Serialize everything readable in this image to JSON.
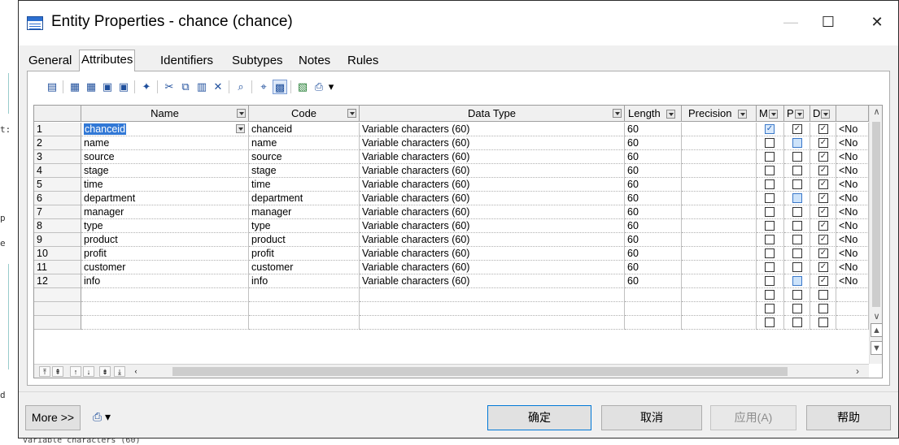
{
  "window": {
    "title": "Entity Properties - chance (chance)"
  },
  "tabs": [
    "General",
    "Attributes",
    "Identifiers",
    "Subtypes",
    "Notes",
    "Rules"
  ],
  "active_tab": "Attributes",
  "grid": {
    "headers": {
      "name": "Name",
      "code": "Code",
      "data_type": "Data Type",
      "length": "Length",
      "precision": "Precision",
      "m": "M",
      "p": "P",
      "d": "D"
    },
    "rows": [
      {
        "num": "1",
        "name": "chanceid",
        "code": "chanceid",
        "data_type": "Variable characters (60)",
        "length": "60",
        "precision": "",
        "m": "bluecheck",
        "p": "checked",
        "d": "checked",
        "extra": "<No"
      },
      {
        "num": "2",
        "name": "name",
        "code": "name",
        "data_type": "Variable characters (60)",
        "length": "60",
        "precision": "",
        "m": "empty",
        "p": "blue",
        "d": "checked",
        "extra": "<No"
      },
      {
        "num": "3",
        "name": "source",
        "code": "source",
        "data_type": "Variable characters (60)",
        "length": "60",
        "precision": "",
        "m": "empty",
        "p": "empty",
        "d": "checked",
        "extra": "<No"
      },
      {
        "num": "4",
        "name": "stage",
        "code": "stage",
        "data_type": "Variable characters (60)",
        "length": "60",
        "precision": "",
        "m": "empty",
        "p": "empty",
        "d": "checked",
        "extra": "<No"
      },
      {
        "num": "5",
        "name": "time",
        "code": "time",
        "data_type": "Variable characters (60)",
        "length": "60",
        "precision": "",
        "m": "empty",
        "p": "empty",
        "d": "checked",
        "extra": "<No"
      },
      {
        "num": "6",
        "name": "department",
        "code": "department",
        "data_type": "Variable characters (60)",
        "length": "60",
        "precision": "",
        "m": "empty",
        "p": "blue",
        "d": "checked",
        "extra": "<No"
      },
      {
        "num": "7",
        "name": "manager",
        "code": "manager",
        "data_type": "Variable characters (60)",
        "length": "60",
        "precision": "",
        "m": "empty",
        "p": "empty",
        "d": "checked",
        "extra": "<No"
      },
      {
        "num": "8",
        "name": "type",
        "code": "type",
        "data_type": "Variable characters (60)",
        "length": "60",
        "precision": "",
        "m": "empty",
        "p": "empty",
        "d": "checked",
        "extra": "<No"
      },
      {
        "num": "9",
        "name": "product",
        "code": "product",
        "data_type": "Variable characters (60)",
        "length": "60",
        "precision": "",
        "m": "empty",
        "p": "empty",
        "d": "checked",
        "extra": "<No"
      },
      {
        "num": "10",
        "name": "profit",
        "code": "profit",
        "data_type": "Variable characters (60)",
        "length": "60",
        "precision": "",
        "m": "empty",
        "p": "empty",
        "d": "checked",
        "extra": "<No"
      },
      {
        "num": "11",
        "name": "customer",
        "code": "customer",
        "data_type": "Variable characters (60)",
        "length": "60",
        "precision": "",
        "m": "empty",
        "p": "empty",
        "d": "checked",
        "extra": "<No"
      },
      {
        "num": "12",
        "name": "info",
        "code": "info",
        "data_type": "Variable characters (60)",
        "length": "60",
        "precision": "",
        "m": "empty",
        "p": "blue",
        "d": "checked",
        "extra": "<No"
      }
    ],
    "empty_rows": 3
  },
  "buttons": {
    "more": "More >>",
    "ok": "确定",
    "cancel": "取消",
    "apply": "应用(A)",
    "help": "帮助"
  },
  "background": {
    "bottom_text": "Variable characters (60)",
    "side_fragments": [
      "t:",
      "p",
      "e",
      "d"
    ]
  }
}
